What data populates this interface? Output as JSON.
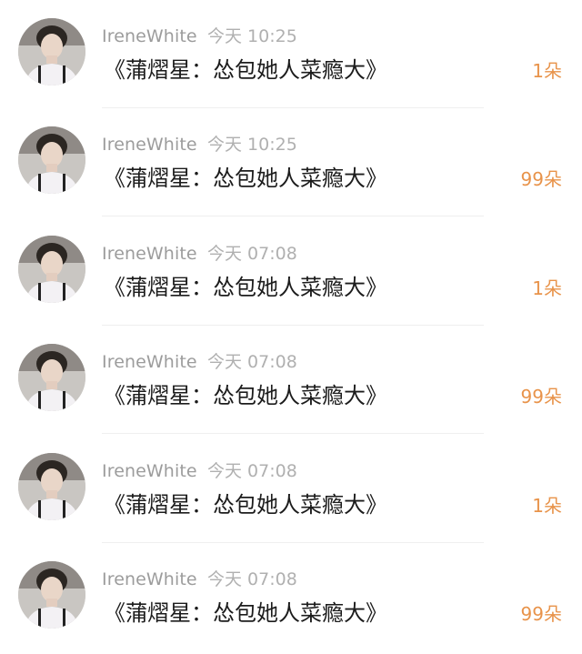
{
  "gifts": [
    {
      "user": "IreneWhite",
      "time": "今天 10:25",
      "message": "《蒲熠星：怂包她人菜瘾大》",
      "flowers": "1朵"
    },
    {
      "user": "IreneWhite",
      "time": "今天 10:25",
      "message": "《蒲熠星：怂包她人菜瘾大》",
      "flowers": "99朵"
    },
    {
      "user": "IreneWhite",
      "time": "今天 07:08",
      "message": "《蒲熠星：怂包她人菜瘾大》",
      "flowers": "1朵"
    },
    {
      "user": "IreneWhite",
      "time": "今天 07:08",
      "message": "《蒲熠星：怂包她人菜瘾大》",
      "flowers": "99朵"
    },
    {
      "user": "IreneWhite",
      "time": "今天 07:08",
      "message": "《蒲熠星：怂包她人菜瘾大》",
      "flowers": "1朵"
    },
    {
      "user": "IreneWhite",
      "time": "今天 07:08",
      "message": "《蒲熠星：怂包她人菜瘾大》",
      "flowers": "99朵"
    }
  ],
  "colors": {
    "flowers_accent": "#e8934a",
    "username": "#9c9c9c",
    "time": "#b0b0b0",
    "message": "#1c1c1c"
  },
  "icons": {
    "avatar": "user-photo-avatar"
  }
}
